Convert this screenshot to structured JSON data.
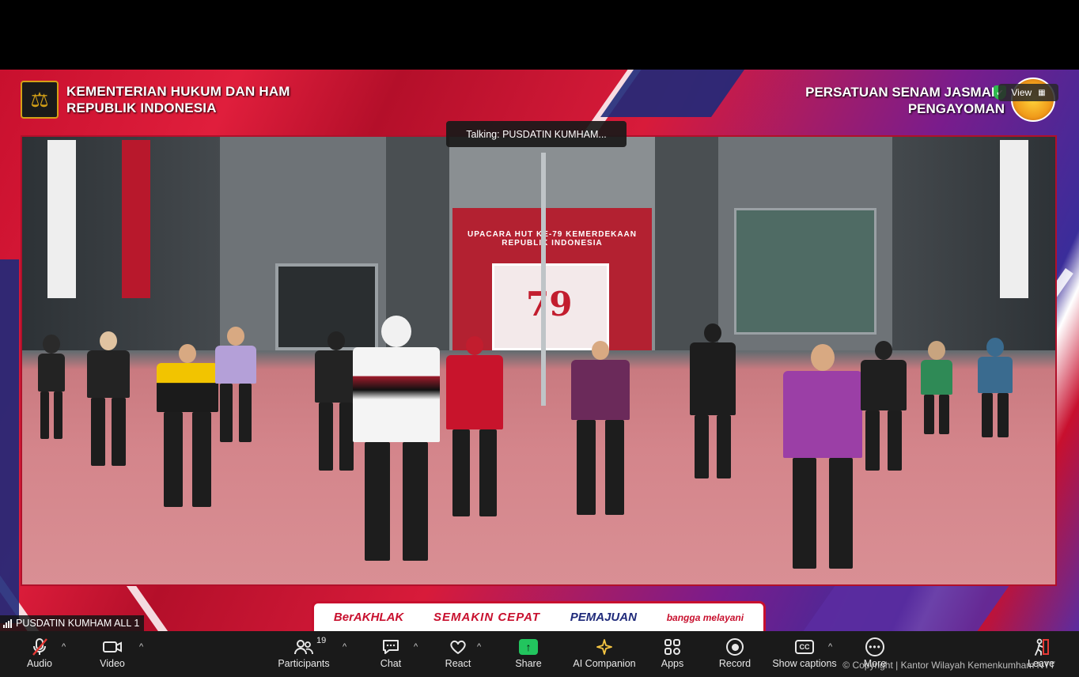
{
  "stage": {
    "org_line1": "KEMENTERIAN HUKUM DAN HAM",
    "org_line2": "REPUBLIK INDONESIA",
    "event_line1": "PERSATUAN SENAM JASMANI",
    "event_line2": "PENGAYOMAN",
    "venue_banner": "UPACARA HUT KE-79 KEMERDEKAAN REPUBLIK INDONESIA",
    "venue_number": "79"
  },
  "view_button": {
    "label": "View"
  },
  "talking": {
    "label": "Talking:",
    "name": "PUSDATIN  KUMHAM..."
  },
  "bottom_banner": {
    "t1": "BerAKHLAK",
    "t2": "SEMAKIN CEPAT",
    "t3": "PEMAJUAN",
    "t4": "bangga melayani"
  },
  "participant_label": "PUSDATIN KUMHAM ALL 1",
  "toolbar": {
    "audio": "Audio",
    "video": "Video",
    "participants": "Participants",
    "participants_count": "19",
    "chat": "Chat",
    "react": "React",
    "share": "Share",
    "ai_companion": "AI Companion",
    "apps": "Apps",
    "record": "Record",
    "captions": "Show captions",
    "more": "More",
    "leave": "Leave",
    "copyright": "© Copyright | Kantor Wilayah Kemenkumham NTT"
  },
  "colors": {
    "brand_red": "#c8102e",
    "share_green": "#22c55e",
    "toolbar_bg": "#1a1a1a"
  }
}
